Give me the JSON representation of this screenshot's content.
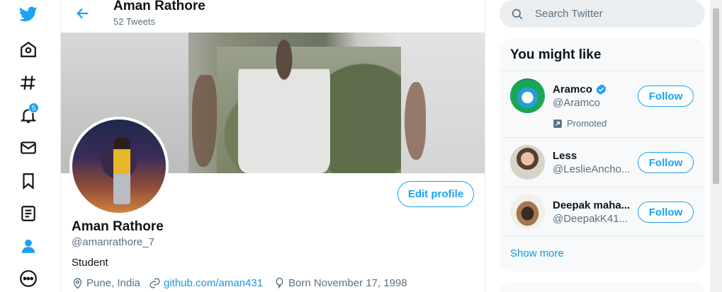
{
  "nav": {
    "items": [
      {
        "name": "twitter-logo-icon",
        "label": "Twitter"
      },
      {
        "name": "home-icon",
        "label": "Home"
      },
      {
        "name": "explore-icon",
        "label": "Explore"
      },
      {
        "name": "notifications-icon",
        "label": "Notifications"
      },
      {
        "name": "messages-icon",
        "label": "Messages"
      },
      {
        "name": "bookmarks-icon",
        "label": "Bookmarks"
      },
      {
        "name": "lists-icon",
        "label": "Lists"
      },
      {
        "name": "profile-icon",
        "label": "Profile"
      },
      {
        "name": "more-icon",
        "label": "More"
      }
    ],
    "notification_count": "5"
  },
  "header": {
    "name": "Aman Rathore",
    "tweet_count": "52 Tweets"
  },
  "profile": {
    "name": "Aman Rathore",
    "handle": "@amanrathore_7",
    "bio": "Student",
    "location": "Pune, India",
    "website": "github.com/aman431",
    "born": "Born November 17, 1998",
    "edit_label": "Edit profile"
  },
  "search": {
    "placeholder": "Search Twitter"
  },
  "sidebar": {
    "title": "You might like",
    "suggestions": [
      {
        "name": "Aramco",
        "handle": "@Aramco",
        "verified": true,
        "promoted": "Promoted",
        "follow_label": "Follow"
      },
      {
        "name": "Less",
        "handle": "@LeslieAncho...",
        "follow_label": "Follow"
      },
      {
        "name": "Deepak maha...",
        "handle": "@DeepakK41...",
        "follow_label": "Follow"
      }
    ],
    "show_more": "Show more"
  },
  "colors": {
    "accent": "#1da1f2",
    "link": "#1b95e0",
    "secondary_text": "#5b7083",
    "card_bg": "#f7f9fa"
  }
}
